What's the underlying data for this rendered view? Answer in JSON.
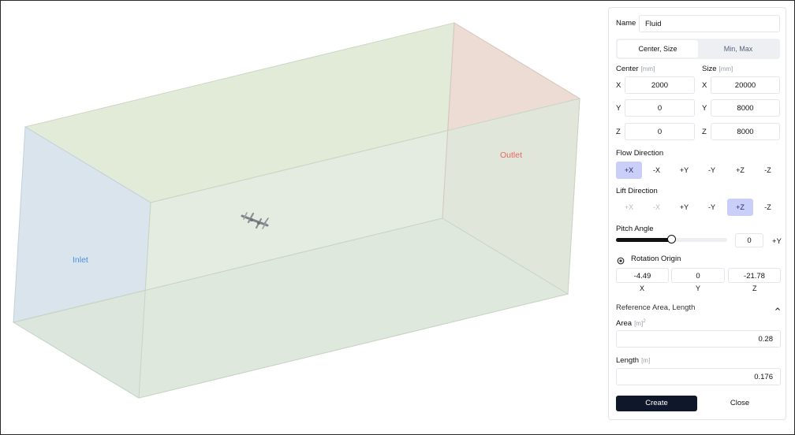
{
  "viewport": {
    "inlet_label": "Inlet",
    "outlet_label": "Outlet"
  },
  "panel": {
    "name_label": "Name",
    "name_value": "Fluid",
    "mode_tabs": [
      "Center, Size",
      "Min, Max"
    ],
    "center": {
      "label": "Center",
      "unit": "[mm]",
      "x": "2000",
      "y": "0",
      "z": "0"
    },
    "size": {
      "label": "Size",
      "unit": "[mm]",
      "x": "20000",
      "y": "8000",
      "z": "8000"
    },
    "axis_labels": [
      "X",
      "Y",
      "Z"
    ],
    "flow_direction": {
      "label": "Flow Direction",
      "options": [
        "+X",
        "-X",
        "+Y",
        "-Y",
        "+Z",
        "-Z"
      ],
      "selected": "+X"
    },
    "lift_direction": {
      "label": "Lift Direction",
      "options": [
        "+X",
        "-X",
        "+Y",
        "-Y",
        "+Z",
        "-Z"
      ],
      "selected": "+Z",
      "disabled": [
        "+X",
        "-X"
      ]
    },
    "pitch_angle": {
      "label": "Pitch Angle",
      "value": "0",
      "axis": "+Y",
      "slider_fraction": 0.5
    },
    "rotation_origin": {
      "label": "Rotation Origin",
      "x": "-4.49",
      "y": "0",
      "z": "-21.78"
    },
    "reference": {
      "label": "Reference Area, Length",
      "area_label": "Area",
      "area_unit": "[m]",
      "area_unit_sup": "2",
      "area_value": "0.28",
      "length_label": "Length",
      "length_unit": "[m]",
      "length_value": "0.176"
    },
    "buttons": {
      "create": "Create",
      "close": "Close"
    }
  },
  "colors": {
    "accent": "#0f172a",
    "selected_chip": "#c9cff8",
    "inlet_text": "#4a90e2",
    "outlet_text": "#e8665c"
  }
}
